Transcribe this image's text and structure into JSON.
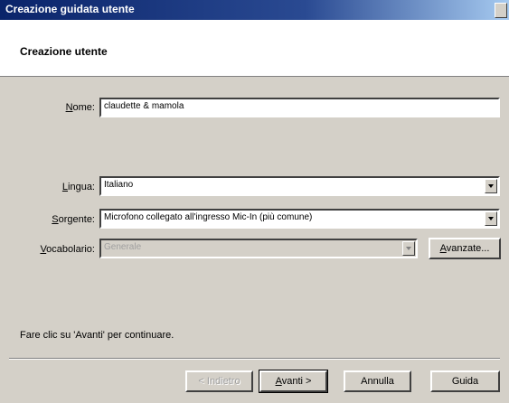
{
  "window": {
    "title": "Creazione guidata utente"
  },
  "header": {
    "title": "Creazione utente"
  },
  "form": {
    "name_label_u": "N",
    "name_label_rest": "ome:",
    "name_value": "claudette & mamola",
    "language_label_u": "L",
    "language_label_rest": "ingua:",
    "language_value": "Italiano",
    "source_label_u": "S",
    "source_label_rest": "orgente:",
    "source_value": "Microfono collegato all'ingresso Mic-In (più comune)",
    "vocabulary_label_u": "V",
    "vocabulary_label_rest": "ocabolario:",
    "vocabulary_value": "Generale",
    "advanced_u": "A",
    "advanced_rest": "vanzate..."
  },
  "instruction": "Fare clic su 'Avanti' per continuare.",
  "buttons": {
    "back": "< Indietro",
    "next_u": "A",
    "next_rest": "vanti >",
    "cancel": "Annulla",
    "help": "Guida"
  }
}
